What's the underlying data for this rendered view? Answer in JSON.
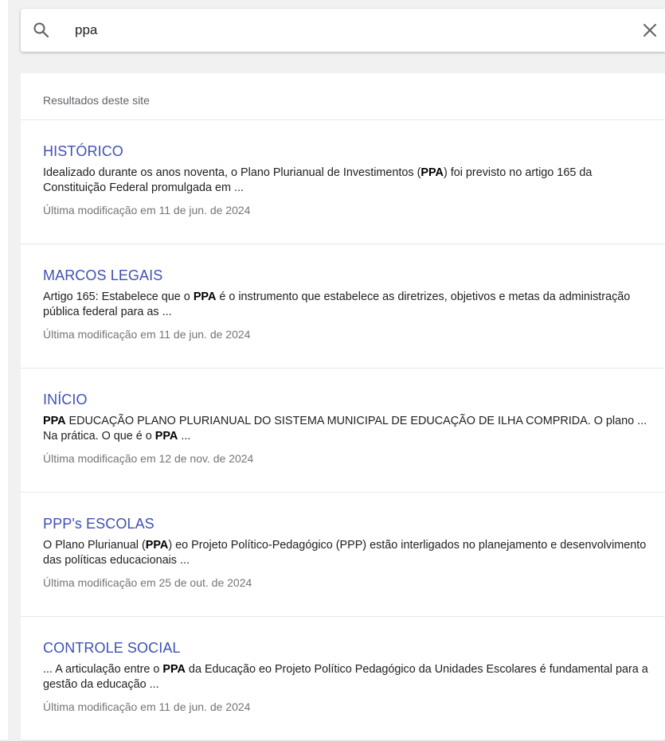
{
  "search": {
    "query": "ppa",
    "search_icon": "search-icon",
    "clear_icon": "close-icon"
  },
  "results_header": "Resultados deste site",
  "results": [
    {
      "title": "HISTÓRICO",
      "snippet": [
        {
          "text": "Idealizado durante os anos noventa, o Plano Plurianual de Investimentos (",
          "bold": false
        },
        {
          "text": "PPA",
          "bold": true
        },
        {
          "text": ") foi previsto no artigo 165 da Constituição Federal promulgada em ...",
          "bold": false
        }
      ],
      "date": "Última modificação em 11 de jun. de 2024"
    },
    {
      "title": "MARCOS LEGAIS",
      "snippet": [
        {
          "text": "Artigo 165: Estabelece que o ",
          "bold": false
        },
        {
          "text": "PPA",
          "bold": true
        },
        {
          "text": " é o instrumento que estabelece as diretrizes, objetivos e metas da administração pública federal para as ...",
          "bold": false
        }
      ],
      "date": "Última modificação em 11 de jun. de 2024"
    },
    {
      "title": "INÍCIO",
      "snippet": [
        {
          "text": "PPA",
          "bold": true
        },
        {
          "text": " EDUCAÇÃO PLANO PLURIANUAL DO SISTEMA MUNICIPAL DE EDUCAÇÃO DE ILHA COMPRIDA. O plano ... Na prática. O que é o ",
          "bold": false
        },
        {
          "text": "PPA",
          "bold": true
        },
        {
          "text": " ...",
          "bold": false
        }
      ],
      "date": "Última modificação em 12 de nov. de 2024"
    },
    {
      "title": "PPP's ESCOLAS",
      "snippet": [
        {
          "text": "O Plano Plurianual (",
          "bold": false
        },
        {
          "text": "PPA",
          "bold": true
        },
        {
          "text": ") eo Projeto Político-Pedagógico (PPP) estão interligados no planejamento e desenvolvimento das políticas educacionais ...",
          "bold": false
        }
      ],
      "date": "Última modificação em 25 de out. de 2024"
    },
    {
      "title": "CONTROLE SOCIAL",
      "snippet": [
        {
          "text": "... A articulação entre o ",
          "bold": false
        },
        {
          "text": "PPA",
          "bold": true
        },
        {
          "text": " da Educação eo Projeto Político Pedagógico da Unidades Escolares é fundamental para a gestão da educação ...",
          "bold": false
        }
      ],
      "date": "Última modificação em 11 de jun. de 2024"
    }
  ],
  "colors": {
    "title_link": "#3f51b5",
    "background": "#f1f1f1",
    "date_text": "#757575"
  }
}
